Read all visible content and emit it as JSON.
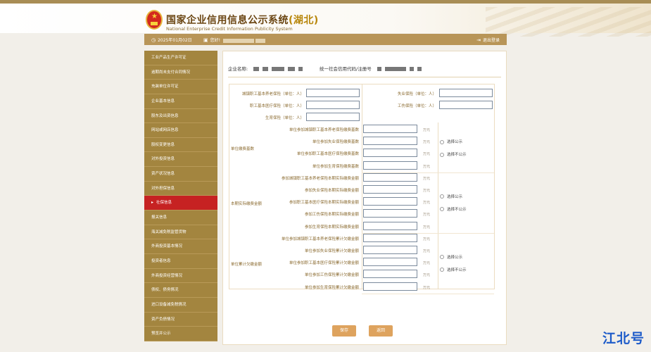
{
  "header": {
    "title_cn": "国家企业信用信息公示系统",
    "title_province": "(湖北)",
    "title_en": "National Enterprise Credit Information Publicity System"
  },
  "topbar": {
    "date": "2025年01月02日",
    "greeting": "您好!",
    "logout": "退出登录"
  },
  "sidebar": {
    "items": [
      {
        "label": "工业产品生产许可证"
      },
      {
        "label": "逾期尚未支付合同情况"
      },
      {
        "label": "充装单位许可证"
      },
      {
        "label": "企业基本信息"
      },
      {
        "label": "股东及出资信息"
      },
      {
        "label": "网站或网店信息"
      },
      {
        "label": "股权变更信息"
      },
      {
        "label": "对外投资信息"
      },
      {
        "label": "资产状况信息"
      },
      {
        "label": "对外担保信息"
      },
      {
        "label": "社保信息"
      },
      {
        "label": "报关信息"
      },
      {
        "label": "海关减免税监管货物"
      },
      {
        "label": "外商投资基本情况"
      },
      {
        "label": "投资者信息"
      },
      {
        "label": "外商投资经营情况"
      },
      {
        "label": "债权、债务情况"
      },
      {
        "label": "进口设备减免税情况"
      },
      {
        "label": "资产负债情况"
      },
      {
        "label": "预览并公示"
      }
    ],
    "active_index": 10
  },
  "company": {
    "name_label": "企业名称:",
    "credit_label": "统一社会信用代码/注册号"
  },
  "form": {
    "top_rows": [
      {
        "left": "城镇职工基本养老保险（单位：人）",
        "right": "失业保险（单位：人）"
      },
      {
        "left": "职工基本医疗保险（单位：人）",
        "right": "工伤保险（单位：人）"
      },
      {
        "left": "生育保险（单位：人）",
        "right": ""
      }
    ],
    "groups": [
      {
        "label": "单位缴费基数",
        "rows": [
          "单位参加城镇职工基本养老保险缴费基数",
          "单位参加失业保险缴费基数",
          "单位参加职工基本医疗保险缴费基数",
          "单位参加生育保险缴费基数"
        ]
      },
      {
        "label": "本期实际缴费金额",
        "rows": [
          "参加城镇职工基本养老保险本期实际缴费金额",
          "参加失业保险本期实际缴费金额",
          "参加职工基本医疗保险本期实际缴费金额",
          "参加工伤保险本期实际缴费金额",
          "参加生育保险本期实际缴费金额"
        ]
      },
      {
        "label": "单位累计欠缴金额",
        "rows": [
          "单位参加城镇职工基本养老保险累计欠缴金额",
          "单位参加失业保险累计欠缴金额",
          "单位参加职工基本医疗保险累计欠缴金额",
          "单位参加工伤保险累计欠缴金额",
          "单位参加生育保险累计欠缴金额"
        ]
      }
    ],
    "unit": "万元",
    "publish_option": "选择公示",
    "nopublish_option": "选择不公示"
  },
  "buttons": {
    "save": "保存",
    "back": "返回"
  },
  "watermark": "江北号"
}
